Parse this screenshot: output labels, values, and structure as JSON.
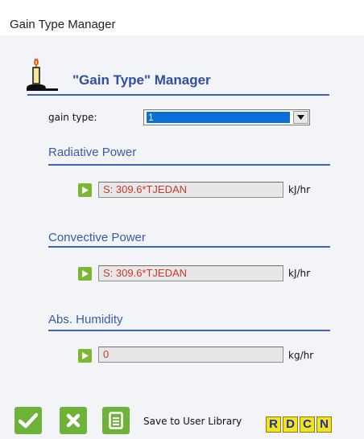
{
  "window": {
    "title": "Gain Type Manager"
  },
  "header": {
    "title": "\"Gain Type\" Manager",
    "icon": "candle-icon"
  },
  "gain_type": {
    "label": "gain type:",
    "value": "1"
  },
  "sections": [
    {
      "title": "Radiative Power",
      "value": "S: 309.6*TJEDAN",
      "unit": "kJ/hr"
    },
    {
      "title": "Convective Power",
      "value": "S: 309.6*TJEDAN",
      "unit": "kJ/hr"
    },
    {
      "title": "Abs. Humidity",
      "value": "0",
      "unit": "kg/hr"
    }
  ],
  "footer": {
    "save_label": "Save to User Library",
    "letters": [
      "R",
      "D",
      "C",
      "N"
    ]
  },
  "colors": {
    "accent": "#2f4fa0",
    "green": "#6fb23a",
    "field_text": "#c83a2a",
    "letter_bg": "#f3e21f"
  }
}
